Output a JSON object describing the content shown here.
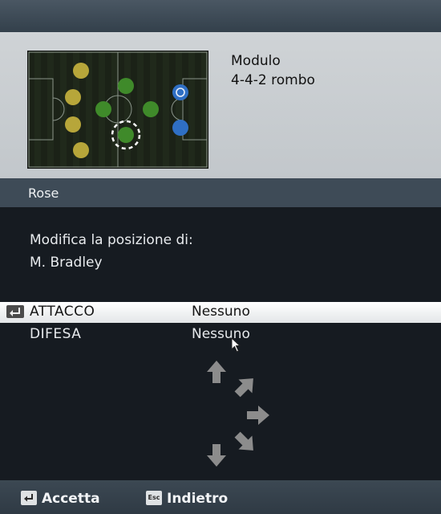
{
  "formation": {
    "module_label": "Modulo",
    "module_value": "4-4-2 rombo"
  },
  "section": {
    "title": "Rose"
  },
  "instruction": {
    "line1": "Modifica la posizione di:",
    "player": "M. Bradley"
  },
  "options": [
    {
      "label": "ATTACCO",
      "value": "Nessuno",
      "selected": true
    },
    {
      "label": "DIFESA",
      "value": "Nessuno",
      "selected": false
    }
  ],
  "footer": {
    "accept_label": "Accetta",
    "back_label": "Indietro",
    "esc_key": "Esc"
  },
  "colors": {
    "yellow_team": "#b7a63a",
    "green_team": "#3f8a2a",
    "blue_team": "#2f6fc4",
    "selected_row": "#ffffff"
  }
}
